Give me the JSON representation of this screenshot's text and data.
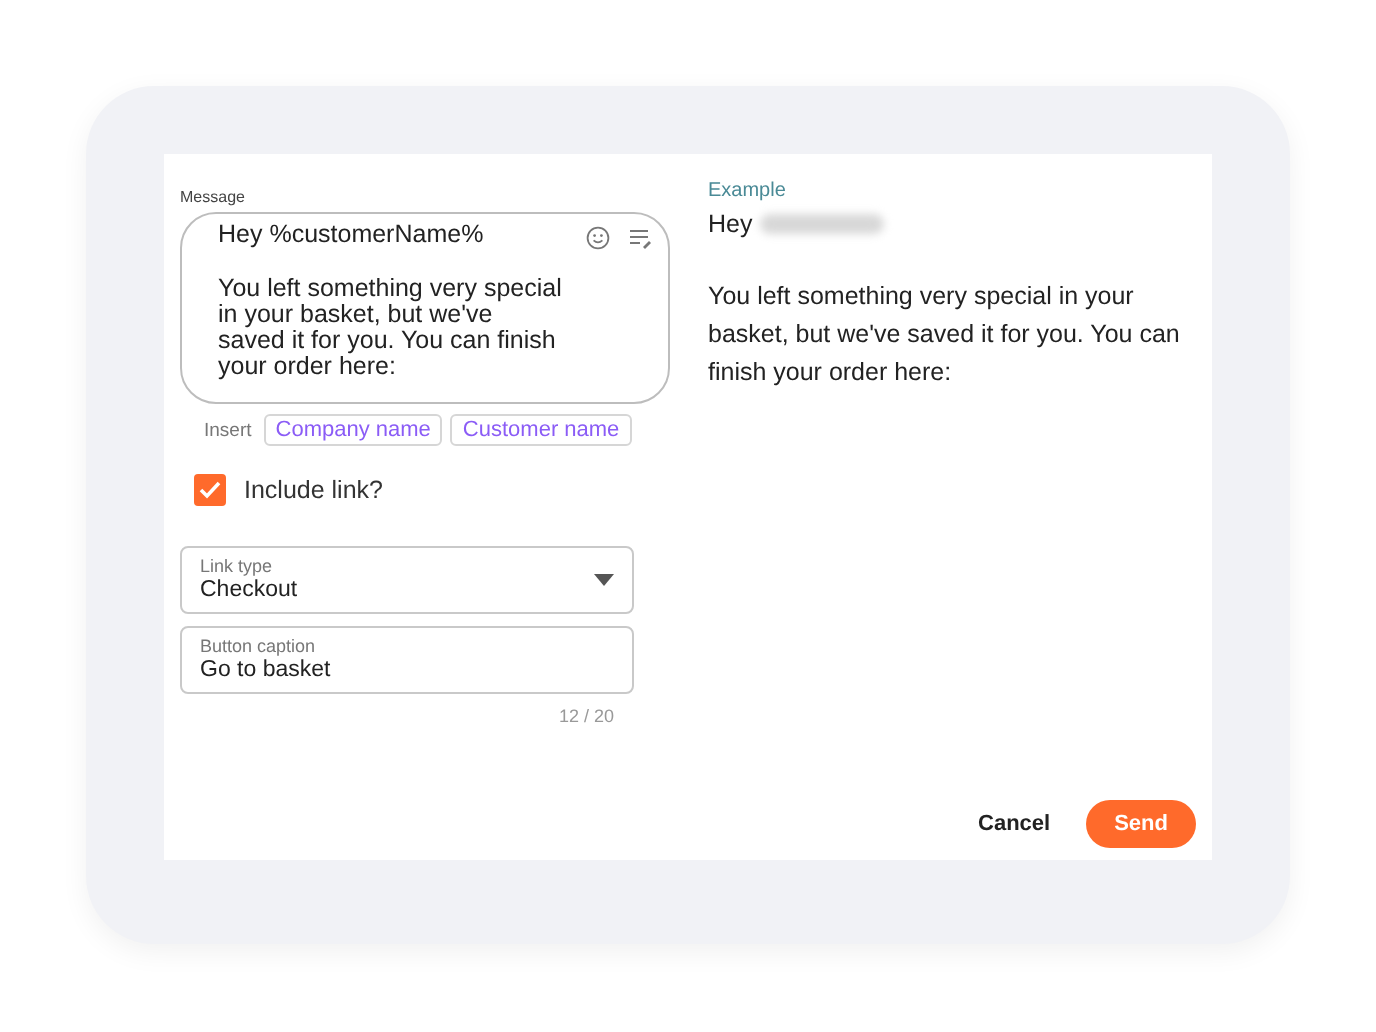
{
  "message": {
    "label": "Message",
    "text": "Hey %customerName%\n\nYou left something very special\nin your basket, but we've\nsaved it for you. You can finish\nyour order here:"
  },
  "insert": {
    "label": "Insert",
    "chips": [
      "Company name",
      "Customer name"
    ]
  },
  "include_link": {
    "label": "Include link?",
    "checked": true
  },
  "link_type": {
    "label": "Link type",
    "value": "Checkout"
  },
  "button_caption": {
    "label": "Button caption",
    "value": "Go to basket",
    "counter": "12 / 20"
  },
  "example": {
    "label": "Example",
    "greeting": "Hey",
    "body": "You left something very special in your basket, but we've saved it for you. You can finish your order here:"
  },
  "buttons": [
    {
      "label": "Cancel",
      "kind": "text"
    },
    {
      "label": "Send",
      "kind": "primary"
    }
  ]
}
